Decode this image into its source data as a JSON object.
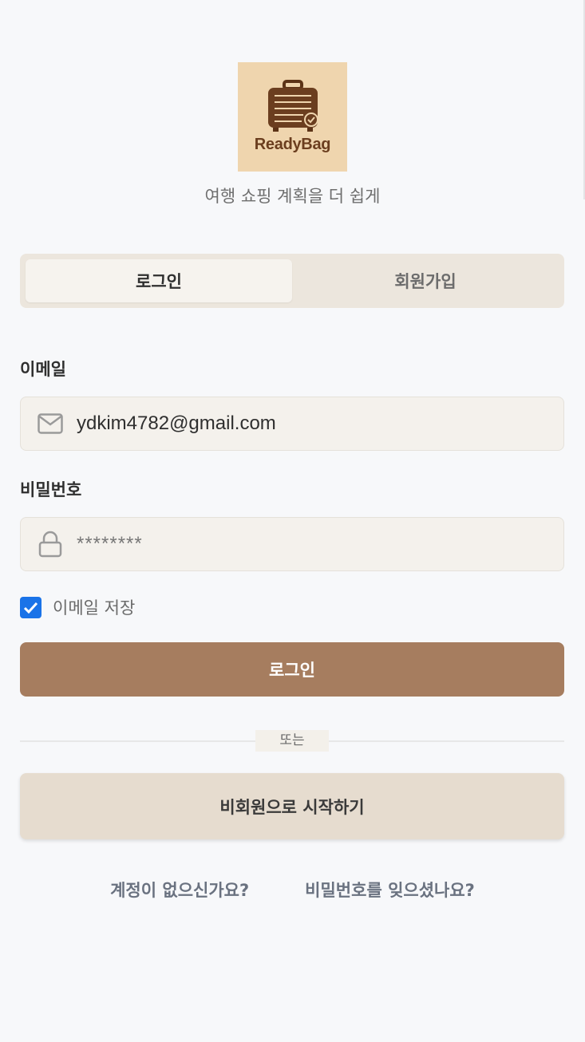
{
  "brand": {
    "logo_text": "ReadyBag",
    "tagline": "여행 쇼핑 계획을 더 쉽게"
  },
  "tabs": [
    {
      "label": "로그인",
      "active": true
    },
    {
      "label": "회원가입",
      "active": false
    }
  ],
  "email": {
    "label": "이메일",
    "value": "ydkim4782@gmail.com",
    "icon": "mail-icon"
  },
  "password": {
    "label": "비밀번호",
    "value": "********",
    "icon": "lock-icon"
  },
  "remember": {
    "label": "이메일 저장",
    "checked": true
  },
  "login_button": "로그인",
  "divider": "또는",
  "guest_button": "비회원으로 시작하기",
  "links": {
    "signup": "계정이 없으신가요?",
    "forgot": "비밀번호를 잊으셨나요?"
  },
  "colors": {
    "primary": "#a67d5f",
    "logo_bg": "#efd5ae",
    "checkbox": "#1a73e8"
  }
}
